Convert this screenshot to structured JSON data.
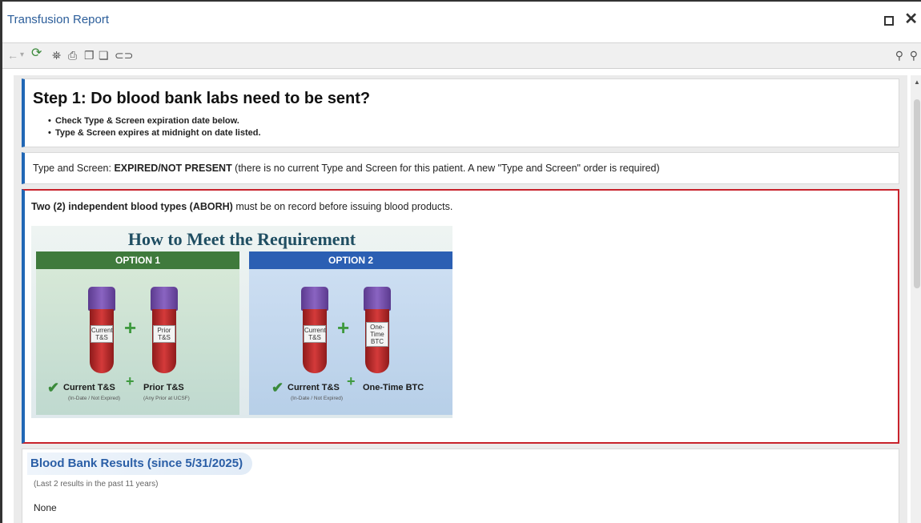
{
  "window": {
    "title": "Transfusion Report"
  },
  "toolbar": {
    "icons": [
      "back-arrow-icon",
      "dropdown-icon",
      "refresh-icon",
      "binoculars-icon",
      "print-icon",
      "copy-icon",
      "paste-icon",
      "link-icon",
      "zoom-out-icon",
      "zoom-in-icon"
    ]
  },
  "step": {
    "title": "Step 1: Do blood bank labs need to be sent?",
    "bullets": [
      "Check Type & Screen expiration date below.",
      "Type & Screen expires at midnight on date listed."
    ]
  },
  "type_screen": {
    "label": "Type and Screen: ",
    "status": "EXPIRED/NOT PRESENT",
    "note": " (there is no current Type and Screen for this patient. A new \"Type and Screen\" order is required)"
  },
  "requirement": {
    "lead_bold": "Two (2) independent blood types (ABORH)",
    "lead_rest": " must be on record before issuing blood products."
  },
  "infographic": {
    "title": "How to Meet the Requirement",
    "option1": {
      "header": "OPTION 1",
      "tube1_label": "Current T&S",
      "tube2_label": "Prior T&S",
      "caption_left": "Current T&S",
      "caption_right": "Prior T&S",
      "note_left": "(In-Date / Not Expired)",
      "note_right": "(Any Prior at UCSF)"
    },
    "option2": {
      "header": "OPTION 2",
      "tube1_label": "Current T&S",
      "tube2_label": "One-Time BTC",
      "caption_left": "Current T&S",
      "caption_right": "One-Time BTC",
      "note_left": "(In-Date / Not Expired)"
    }
  },
  "blood_bank": {
    "title": "Blood Bank Results (since 5/31/2025)",
    "subtitle": "(Last 2 results in the past 11 years)",
    "value": "None"
  },
  "colors": {
    "accent_blue": "#2167b5",
    "highlight_red": "#c8232c",
    "title_blue": "#2c5e9a"
  }
}
